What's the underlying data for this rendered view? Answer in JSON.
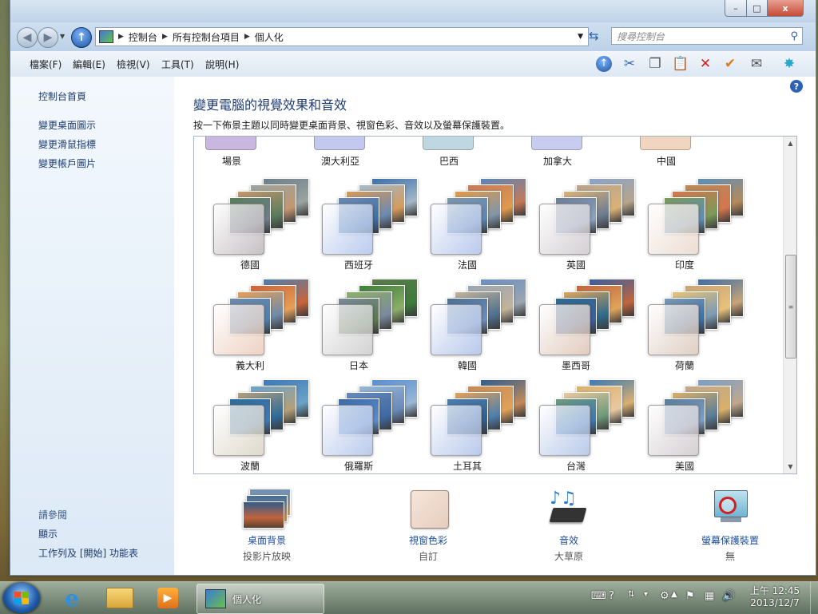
{
  "window": {
    "controls": {
      "minimize": "–",
      "maximize": "□",
      "close": "x"
    }
  },
  "address_bar": {
    "segments": [
      "控制台",
      "所有控制台項目",
      "個人化"
    ],
    "search_placeholder": "搜尋控制台"
  },
  "menu": [
    "檔案(F)",
    "編輯(E)",
    "檢視(V)",
    "工具(T)",
    "說明(H)"
  ],
  "toolbar_icons": [
    "up-arrow-icon",
    "scissors-icon",
    "copy-icon",
    "paste-icon",
    "delete-x-icon",
    "checkmark-icon",
    "mail-icon",
    "shell-icon"
  ],
  "left_pane": {
    "links": [
      "控制台首頁",
      "變更桌面圖示",
      "變更滑鼠指標",
      "變更帳戶圖片"
    ],
    "see_also": "請參閱",
    "see_also_links": [
      "顯示",
      "工作列及 [開始] 功能表"
    ]
  },
  "main": {
    "title": "變更電腦的視覺效果和音效",
    "description": "按一下佈景主題以同時變更桌面背景、視窗色彩、音效以及螢幕保護裝置。",
    "partial_row": [
      {
        "label": "場景",
        "color": "#c9b7e0"
      },
      {
        "label": "澳大利亞",
        "color": "#c3c8ef"
      },
      {
        "label": "巴西",
        "color": "#c0d7e2"
      },
      {
        "label": "加拿大",
        "color": "#c8cdf0"
      },
      {
        "label": "中國",
        "color": "#f0d6c0"
      }
    ],
    "themes": [
      {
        "label": "德國",
        "glass": "#b9b0b5",
        "cards": [
          "#6d7f8a",
          "#9aa4a0",
          "#c49770",
          "#5b7d5d"
        ]
      },
      {
        "label": "西班牙",
        "glass": "#a9bfea",
        "cards": [
          "#3d6fa8",
          "#a5b8c9",
          "#d49b5b",
          "#6d8ab0"
        ]
      },
      {
        "label": "法國",
        "glass": "#a9bde8",
        "cards": [
          "#5a86b8",
          "#c47a5a",
          "#e09a4d",
          "#8096a8"
        ]
      },
      {
        "label": "英國",
        "glass": "#c9c3c8",
        "cards": [
          "#8aa4c8",
          "#b7a48c",
          "#d9b27a",
          "#6d7c92"
        ]
      },
      {
        "label": "印度",
        "glass": "#e7d4c7",
        "cards": [
          "#5d8fb8",
          "#b58a5a",
          "#d4764d",
          "#7a9a5a"
        ]
      },
      {
        "label": "義大利",
        "glass": "#e9c7b3",
        "cards": [
          "#4d7fb0",
          "#c9643b",
          "#e6a05a",
          "#6f8aa8"
        ]
      },
      {
        "label": "日本",
        "glass": "#c8c8c8",
        "cards": [
          "#5b7a4d",
          "#3e7d3a",
          "#8db06a",
          "#7a8a9a"
        ]
      },
      {
        "label": "韓國",
        "glass": "#a6bbe6",
        "cards": [
          "#6c8fbf",
          "#9aa6b2",
          "#c2b39a",
          "#4f6f8f"
        ]
      },
      {
        "label": "墨西哥",
        "glass": "#d9bfae",
        "cards": [
          "#3a5fa0",
          "#c0653e",
          "#e0a45b",
          "#2f6b8a"
        ]
      },
      {
        "label": "荷蘭",
        "glass": "#d8c3b6",
        "cards": [
          "#3d6ea6",
          "#c8a478",
          "#e8c27a",
          "#7a9ab4"
        ]
      },
      {
        "label": "波蘭",
        "glass": "#d8d0bf",
        "cards": [
          "#3f79b6",
          "#6da3c8",
          "#b4a07a",
          "#2f6b9a"
        ]
      },
      {
        "label": "俄羅斯",
        "glass": "#a9bde8",
        "cards": [
          "#5a8ed0",
          "#9ab7d6",
          "#6a8ab8",
          "#3e6aa5"
        ]
      },
      {
        "label": "土耳其",
        "glass": "#a8bce6",
        "cards": [
          "#2f5e8e",
          "#c48a5a",
          "#e2a25a",
          "#4d7fae"
        ]
      },
      {
        "label": "台灣",
        "glass": "#a9bde6",
        "cards": [
          "#3c7ab2",
          "#d9b070",
          "#e8c9a0",
          "#6d9a7a"
        ]
      },
      {
        "label": "美國",
        "glass": "#ccc3c8",
        "cards": [
          "#7d9fc8",
          "#c0a88c",
          "#d8b06a",
          "#5a7d9a"
        ]
      }
    ]
  },
  "settings": [
    {
      "label": "桌面背景",
      "value": "投影片放映",
      "icon": "desktop-background-icon"
    },
    {
      "label": "視窗色彩",
      "value": "自訂",
      "icon": "window-color-icon"
    },
    {
      "label": "音效",
      "value": "大草原",
      "icon": "sounds-icon"
    },
    {
      "label": "螢幕保護裝置",
      "value": "無",
      "icon": "screensaver-icon"
    }
  ],
  "taskbar": {
    "window_title": "個人化",
    "clock": {
      "time": "上午 12:45",
      "date": "2013/12/7"
    }
  },
  "colors": {
    "link_blue": "#1e3b72",
    "title_blue": "#1e3b72",
    "setting_link": "#1e4f9c"
  }
}
